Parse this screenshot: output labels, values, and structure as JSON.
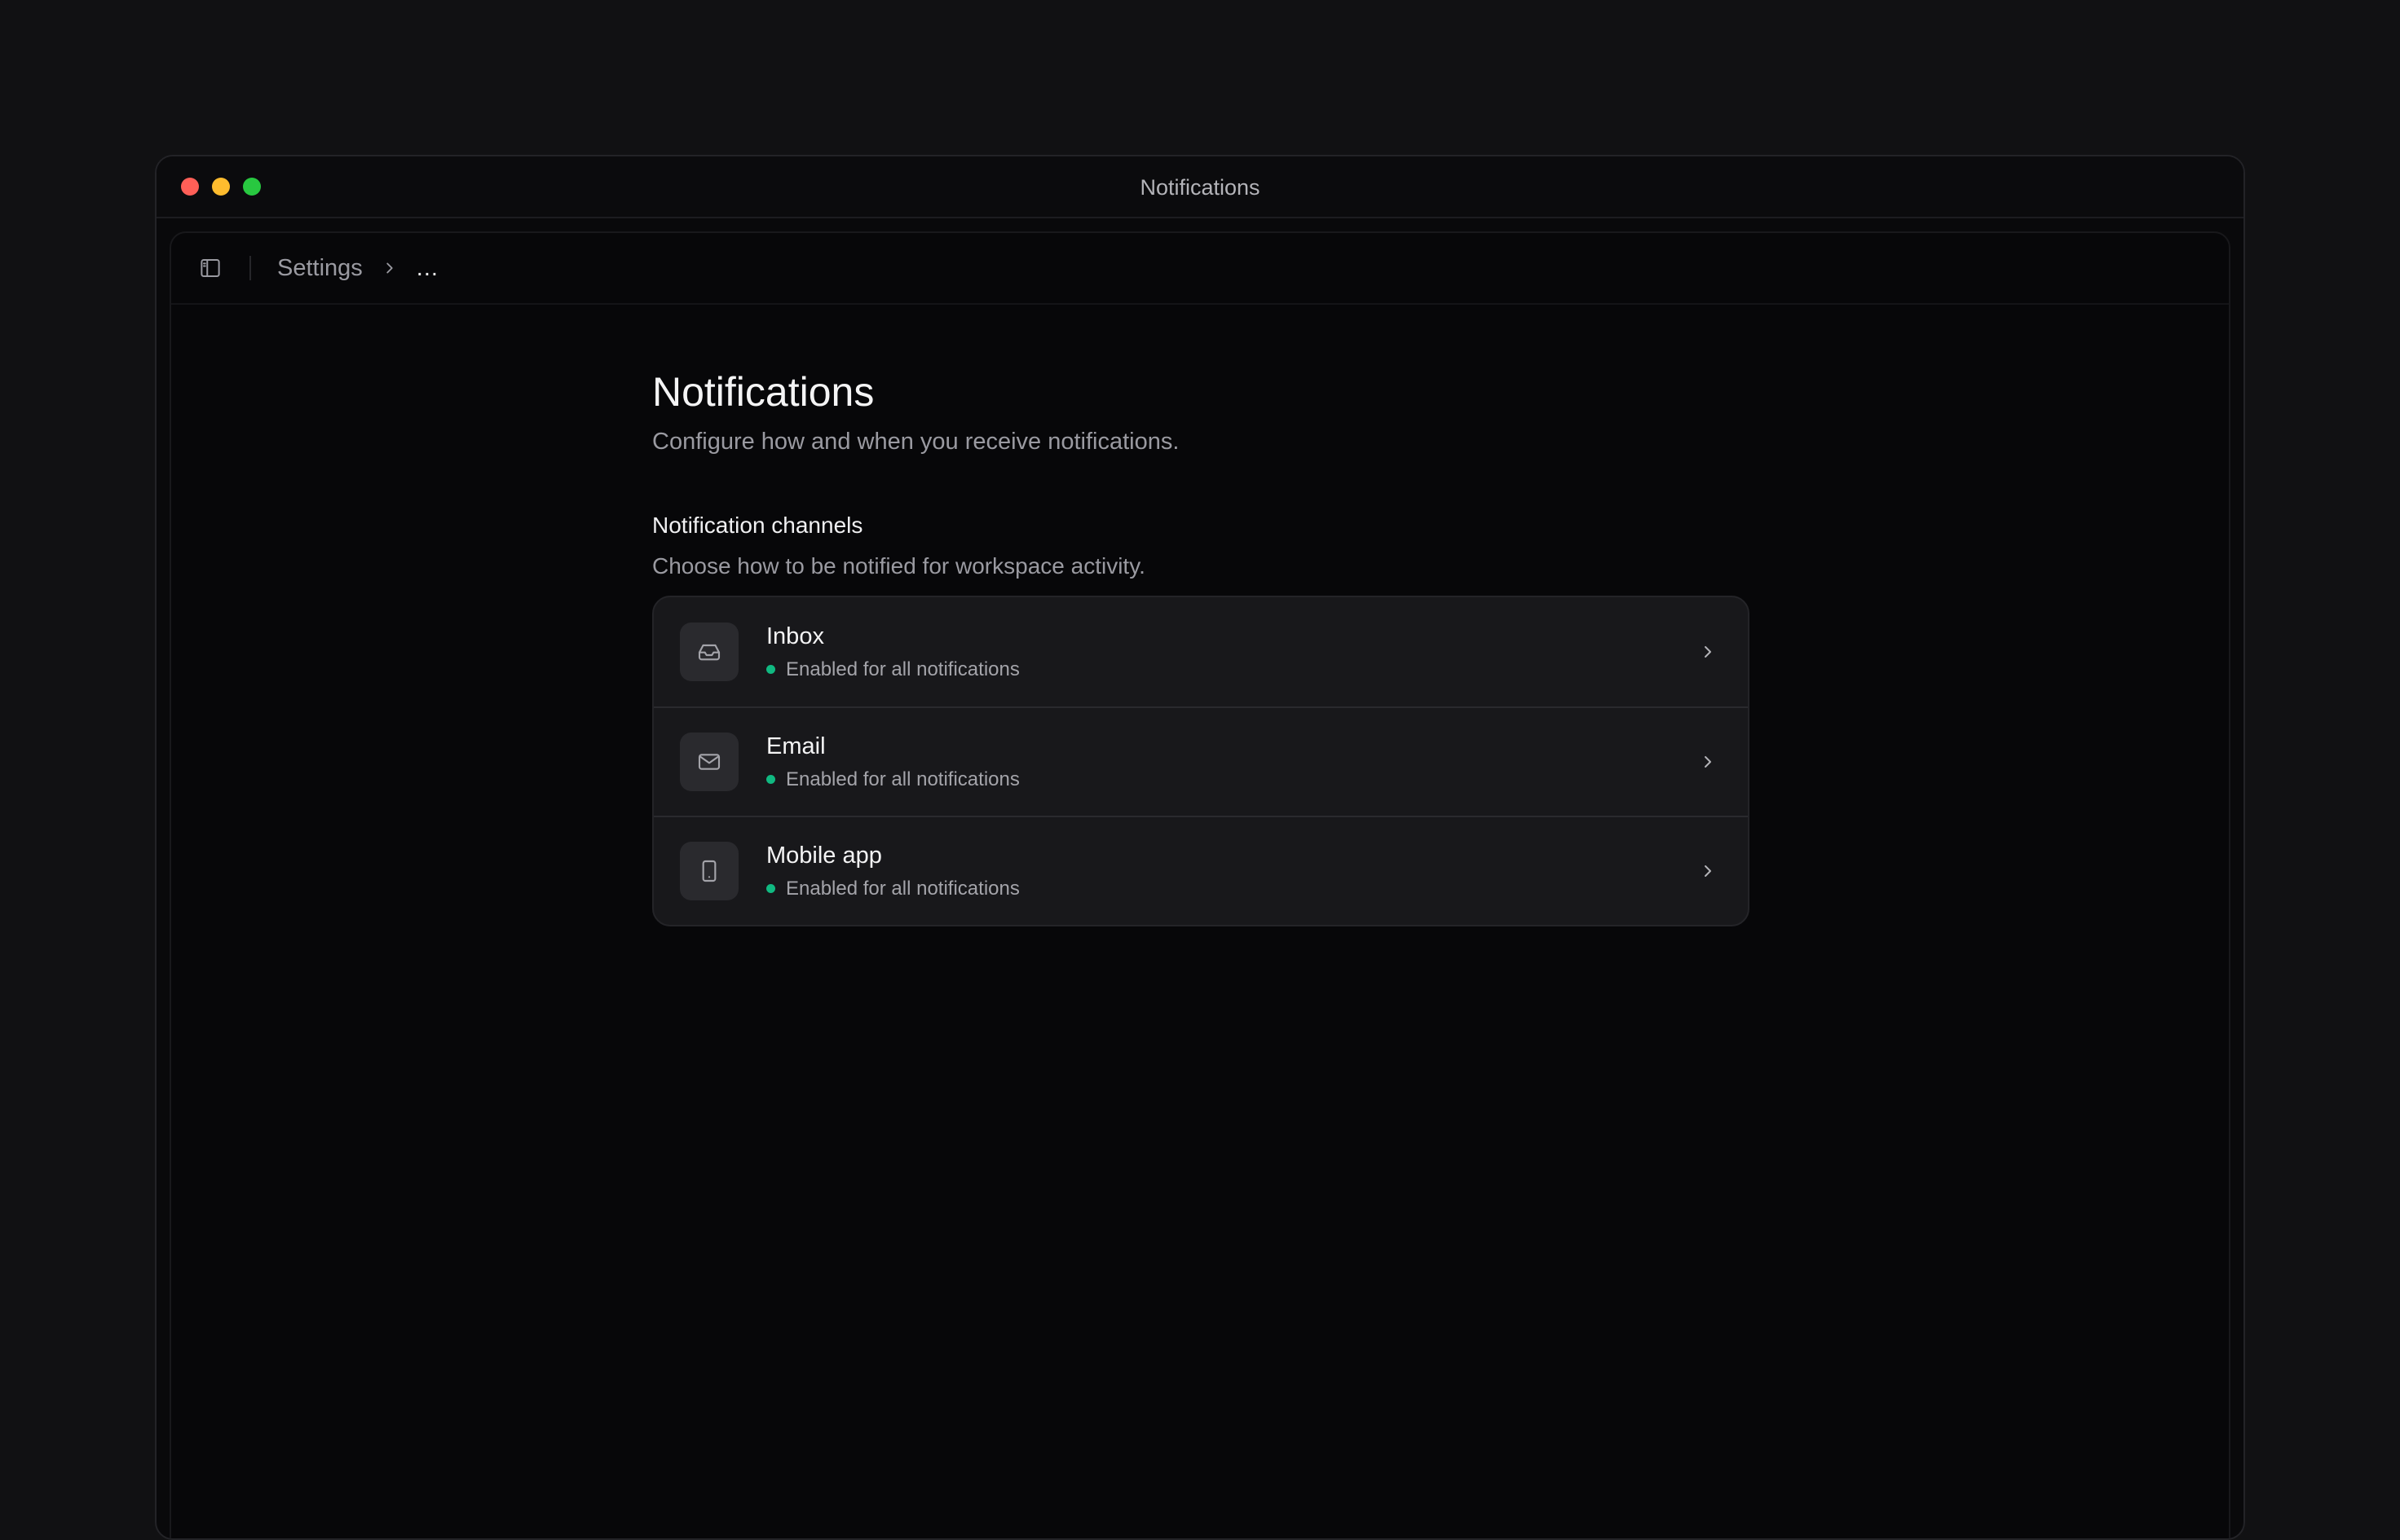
{
  "window": {
    "title": "Notifications"
  },
  "toolbar": {
    "breadcrumb_root": "Settings",
    "breadcrumb_current": "..."
  },
  "page": {
    "title": "Notifications",
    "subtitle": "Configure how and when you receive notifications."
  },
  "section": {
    "title": "Notification channels",
    "subtitle": "Choose how to be notified for workspace activity."
  },
  "channels": [
    {
      "label": "Inbox",
      "status": "Enabled for all notifications",
      "icon": "inbox-icon"
    },
    {
      "label": "Email",
      "status": "Enabled for all notifications",
      "icon": "mail-icon"
    },
    {
      "label": "Mobile app",
      "status": "Enabled for all notifications",
      "icon": "smartphone-icon"
    }
  ],
  "colors": {
    "status_enabled": "#10b981",
    "traffic_red": "#ff5f57",
    "traffic_yellow": "#febc2e",
    "traffic_green": "#28c840"
  }
}
